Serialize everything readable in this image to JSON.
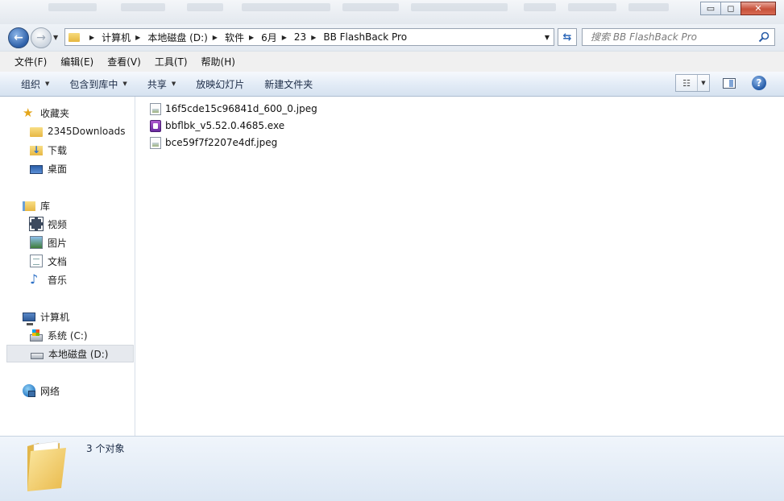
{
  "window": {
    "minimize": "▭",
    "maximize": "◻",
    "close": "✕"
  },
  "address_bar": {
    "crumbs": [
      "计算机",
      "本地磁盘 (D:)",
      "软件",
      "6月",
      "23",
      "BB FlashBack Pro"
    ]
  },
  "search": {
    "placeholder": "搜索 BB FlashBack Pro"
  },
  "menu": [
    "文件(F)",
    "编辑(E)",
    "查看(V)",
    "工具(T)",
    "帮助(H)"
  ],
  "commands": {
    "organize": "组织",
    "include_in_library": "包含到库中",
    "share": "共享",
    "slideshow": "放映幻灯片",
    "new_folder": "新建文件夹"
  },
  "nav_pane": {
    "favorites": "收藏夹",
    "favorites_items": [
      "2345Downloads",
      "下载",
      "桌面"
    ],
    "libraries": "库",
    "libraries_items": [
      "视频",
      "图片",
      "文档",
      "音乐"
    ],
    "computer": "计算机",
    "computer_items": [
      "系统 (C:)",
      "本地磁盘 (D:)"
    ],
    "network": "网络"
  },
  "files": [
    {
      "name": "16f5cde15c96841d_600_0.jpeg",
      "icon": "jpeg-file-icon"
    },
    {
      "name": "bbflbk_v5.52.0.4685.exe",
      "icon": "exe-file-icon"
    },
    {
      "name": "bce59f7f2207e4df.jpeg",
      "icon": "jpeg-file-icon"
    }
  ],
  "status": {
    "count_text": "3 个对象"
  },
  "colors": {
    "command_bar": "#dce7f4",
    "accent": "#2d5fa8",
    "close_button": "#c7513a"
  }
}
